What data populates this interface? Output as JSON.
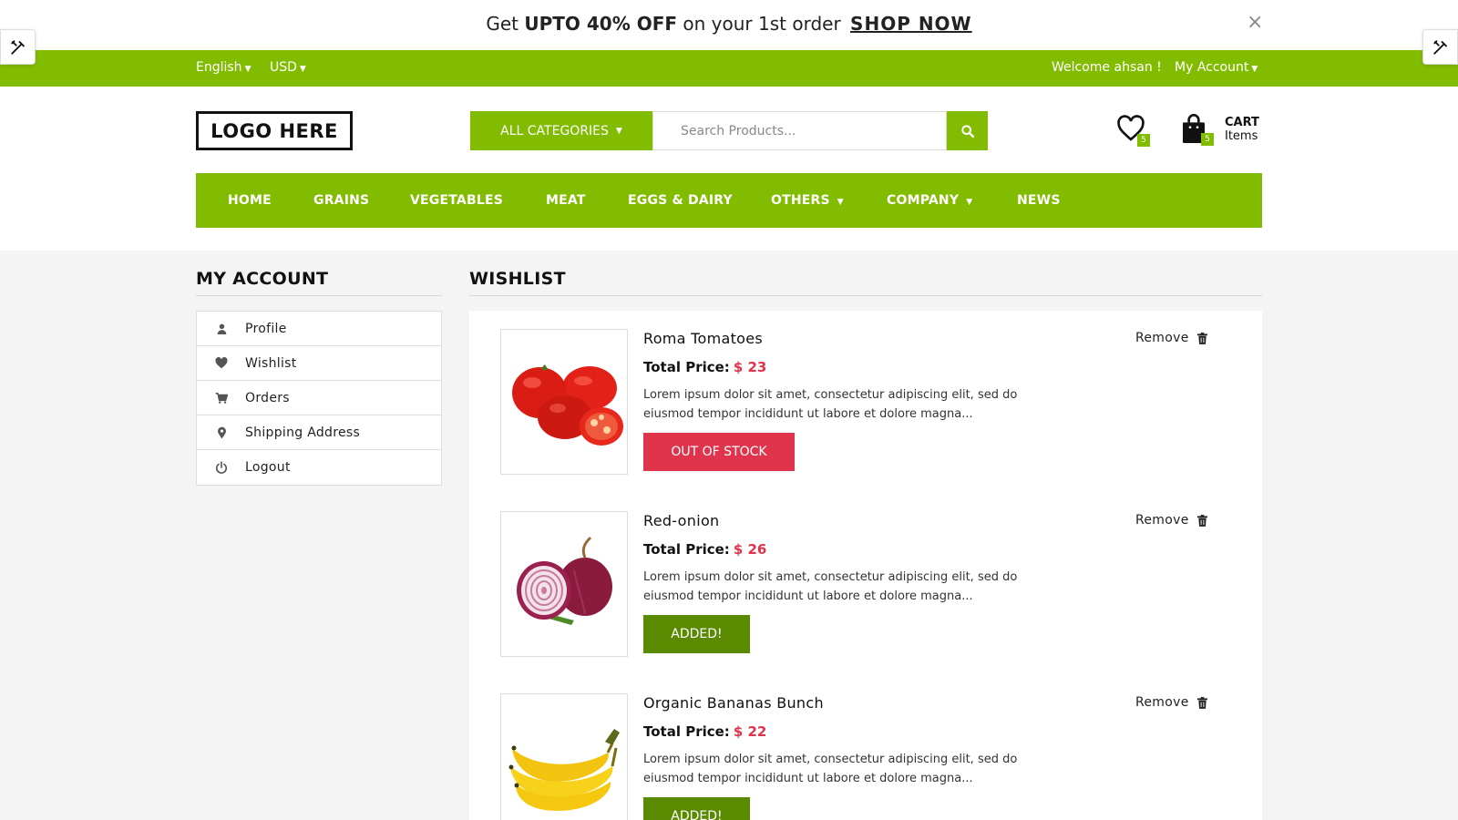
{
  "promo": {
    "prefix": "Get ",
    "highlight": "UPTO 40% OFF",
    "middle": " on your 1st order ",
    "link": "SHOP NOW",
    "close": "×"
  },
  "topbar": {
    "language": "English",
    "currency": "USD",
    "welcome": "Welcome ahsan !",
    "account": "My Account"
  },
  "header": {
    "logo": "LOGO HERE",
    "all_categories": "ALL CATEGORIES",
    "search_placeholder": "Search Products...",
    "wishlist_count": "5",
    "cart_count": "5",
    "cart_label": "CART",
    "cart_sub": "Items"
  },
  "nav": [
    "HOME",
    "GRAINS",
    "VEGETABLES",
    "MEAT",
    "EGGS & DAIRY",
    "OTHERS",
    "COMPANY",
    "NEWS"
  ],
  "account": {
    "title": "MY ACCOUNT",
    "items": [
      {
        "label": "Profile",
        "icon": "user-icon"
      },
      {
        "label": "Wishlist",
        "icon": "heart-icon"
      },
      {
        "label": "Orders",
        "icon": "cart-icon"
      },
      {
        "label": "Shipping Address",
        "icon": "map-marker-icon"
      },
      {
        "label": "Logout",
        "icon": "power-icon"
      }
    ]
  },
  "wishlist": {
    "title": "WISHLIST",
    "price_label": "Total Price:",
    "remove_label": "Remove",
    "items": [
      {
        "name": "Roma Tomatoes",
        "price": "$ 23",
        "desc": "Lorem ipsum dolor sit amet, consectetur adipiscing elit, sed do eiusmod tempor incididunt ut labore et dolore magna...",
        "button": "OUT OF STOCK",
        "status": "out-of-stock"
      },
      {
        "name": "Red-onion",
        "price": "$ 26",
        "desc": "Lorem ipsum dolor sit amet, consectetur adipiscing elit, sed do eiusmod tempor incididunt ut labore et dolore magna...",
        "button": "ADDED!",
        "status": "added"
      },
      {
        "name": "Organic Bananas Bunch",
        "price": "$ 22",
        "desc": "Lorem ipsum dolor sit amet, consectetur adipiscing elit, sed do eiusmod tempor incididunt ut labore et dolore magna...",
        "button": "ADDED!",
        "status": "added"
      }
    ]
  },
  "colors": {
    "brand_green": "#82bc00",
    "dark_green": "#5a8a00",
    "price_red": "#e0344c"
  }
}
